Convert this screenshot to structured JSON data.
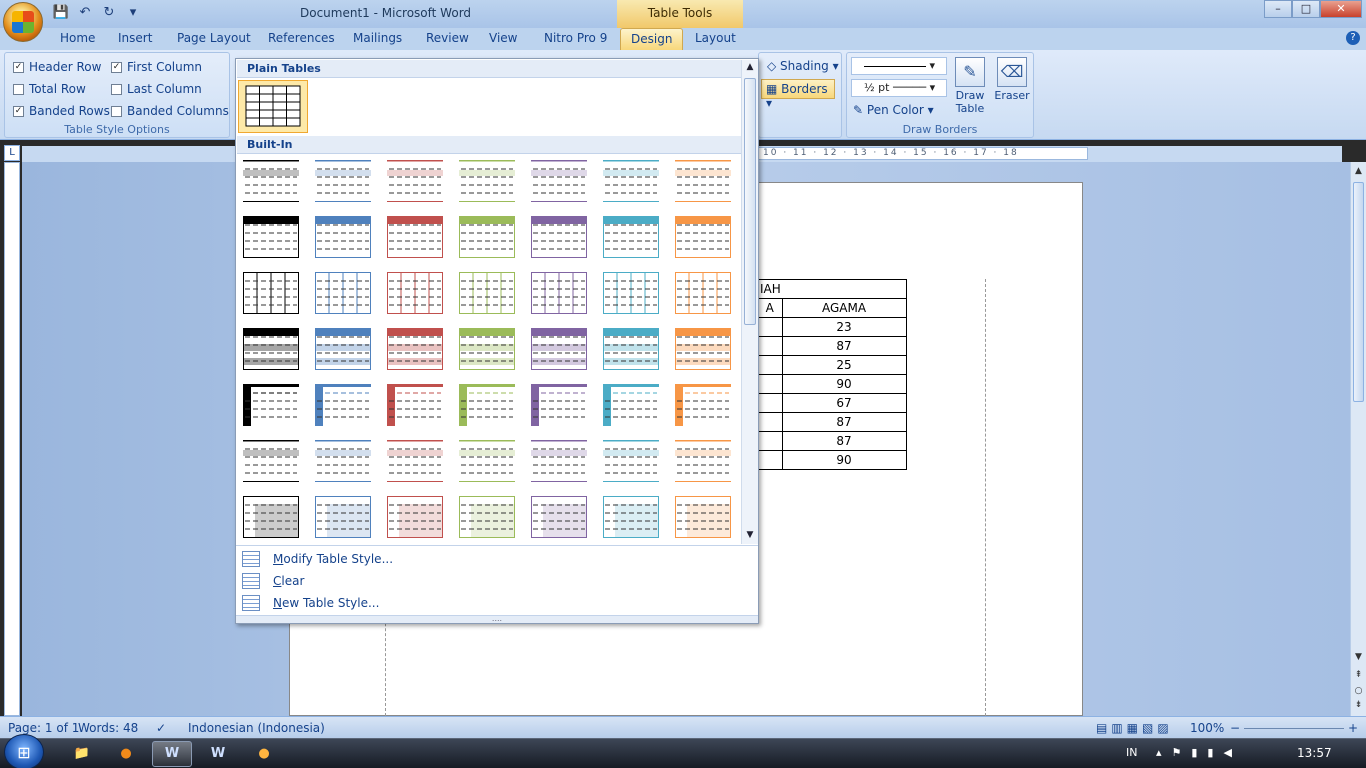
{
  "window": {
    "title": "Document1 - Microsoft Word",
    "context_tab": "Table Tools",
    "minimize": "–",
    "maximize": "□",
    "close": "✕"
  },
  "qat": {
    "save": "💾",
    "undo": "↶",
    "redo": "↻",
    "more": "▾"
  },
  "tabs": [
    "Home",
    "Insert",
    "Page Layout",
    "References",
    "Mailings",
    "Review",
    "View",
    "Nitro Pro 9",
    "Design",
    "Layout"
  ],
  "active_tab": "Design",
  "help": "?",
  "ribbon": {
    "table_style_options": {
      "label": "Table Style Options",
      "options": [
        {
          "label": "Header Row",
          "checked": "✓"
        },
        {
          "label": "First Column",
          "checked": "✓"
        },
        {
          "label": "Total Row",
          "checked": ""
        },
        {
          "label": "Last Column",
          "checked": ""
        },
        {
          "label": "Banded Rows",
          "checked": "✓"
        },
        {
          "label": "Banded Columns",
          "checked": ""
        }
      ]
    },
    "shading": "Shading",
    "borders": "Borders",
    "draw_borders": {
      "label": "Draw Borders",
      "line_weight": "½ pt",
      "pen_color": "Pen Color",
      "draw_table": "Draw Table",
      "eraser": "Eraser"
    }
  },
  "ruler": {
    "ticks": "10 · 11 · 12 · 13 · 14 · 15 · 16 · 17 · 18",
    "tab_selector": "L"
  },
  "document_table": {
    "title": "IAH",
    "header": [
      "A",
      "AGAMA"
    ],
    "values": [
      "23",
      "87",
      "25",
      "90",
      "67",
      "87",
      "87",
      "90"
    ]
  },
  "gallery": {
    "plain_header": "Plain Tables",
    "builtin_header": "Built-In",
    "colors": [
      "#000000",
      "#4f81bd",
      "#c0504d",
      "#9bbb59",
      "#8064a2",
      "#4bacc6",
      "#f79646"
    ],
    "menu": [
      {
        "label": "Modify Table Style...",
        "key": "M",
        "rest": "odify Table Style..."
      },
      {
        "label": "Clear",
        "key": "C",
        "rest": "lear"
      },
      {
        "label": "New Table Style...",
        "key": "N",
        "rest": "ew Table Style..."
      }
    ],
    "grip": "....",
    "scroll_up": "▲",
    "scroll_down": "▼"
  },
  "status": {
    "page": "Page: 1 of 1",
    "words": "Words: 48",
    "language": "Indonesian (Indonesia)",
    "zoom": "100%",
    "zoom_minus": "−",
    "zoom_plus": "+"
  },
  "taskbar": {
    "start": "⊞",
    "apps": [
      {
        "name": "explorer",
        "glyph": "📁"
      },
      {
        "name": "firefox",
        "glyph": "●"
      },
      {
        "name": "word-1",
        "glyph": "W"
      },
      {
        "name": "word-2",
        "glyph": "W"
      },
      {
        "name": "other",
        "glyph": "●"
      }
    ],
    "lang": "IN",
    "time": "13:57"
  }
}
